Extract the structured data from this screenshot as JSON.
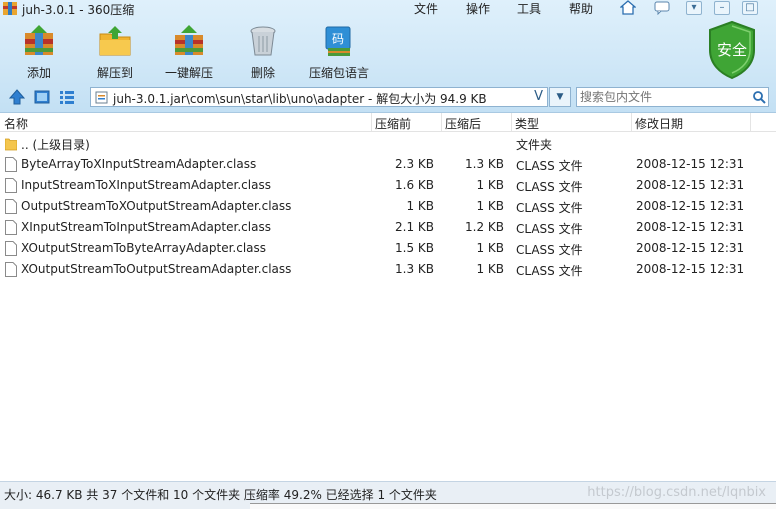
{
  "window": {
    "title": "juh-3.0.1 - 360压缩",
    "menu": [
      "文件",
      "操作",
      "工具",
      "帮助"
    ]
  },
  "toolbar": {
    "buttons": [
      {
        "label": "添加",
        "icon": "add-books-icon"
      },
      {
        "label": "解压到",
        "icon": "extract-folder-icon"
      },
      {
        "label": "一键解压",
        "icon": "one-click-extract-icon"
      },
      {
        "label": "删除",
        "icon": "trash-bin-icon"
      },
      {
        "label": "压缩包语言",
        "icon": "archive-language-icon"
      }
    ],
    "security_badge": "安全"
  },
  "address": {
    "path": "juh-3.0.1.jar\\com\\sun\\star\\lib\\uno\\adapter - 解包大小为 94.9 KB",
    "dropdown_glyph": "V"
  },
  "search": {
    "placeholder": "搜索包内文件"
  },
  "columns": {
    "name": "名称",
    "before": "压缩前",
    "after": "压缩后",
    "type": "类型",
    "date": "修改日期"
  },
  "files": [
    {
      "name": ".. (上级目录)",
      "before": "",
      "after": "",
      "type": "文件夹",
      "date": "",
      "kind": "folder"
    },
    {
      "name": "ByteArrayToXInputStreamAdapter.class",
      "before": "2.3 KB",
      "after": "1.3 KB",
      "type": "CLASS 文件",
      "date": "2008-12-15 12:31",
      "kind": "file"
    },
    {
      "name": "InputStreamToXInputStreamAdapter.class",
      "before": "1.6 KB",
      "after": "1 KB",
      "type": "CLASS 文件",
      "date": "2008-12-15 12:31",
      "kind": "file"
    },
    {
      "name": "OutputStreamToXOutputStreamAdapter.class",
      "before": "1 KB",
      "after": "1 KB",
      "type": "CLASS 文件",
      "date": "2008-12-15 12:31",
      "kind": "file"
    },
    {
      "name": "XInputStreamToInputStreamAdapter.class",
      "before": "2.1 KB",
      "after": "1.2 KB",
      "type": "CLASS 文件",
      "date": "2008-12-15 12:31",
      "kind": "file"
    },
    {
      "name": "XOutputStreamToByteArrayAdapter.class",
      "before": "1.5 KB",
      "after": "1 KB",
      "type": "CLASS 文件",
      "date": "2008-12-15 12:31",
      "kind": "file"
    },
    {
      "name": "XOutputStreamToOutputStreamAdapter.class",
      "before": "1.3 KB",
      "after": "1 KB",
      "type": "CLASS 文件",
      "date": "2008-12-15 12:31",
      "kind": "file"
    }
  ],
  "status": {
    "text": "大小: 46.7 KB 共 37 个文件和 10 个文件夹 压缩率 49.2% 已经选择 1 个文件夹",
    "watermark": "https://blog.csdn.net/lqnbix"
  },
  "colors": {
    "header_bg": "#cfe7f7",
    "shield_green": "#3fa535",
    "accent_blue": "#2c6fb0"
  }
}
